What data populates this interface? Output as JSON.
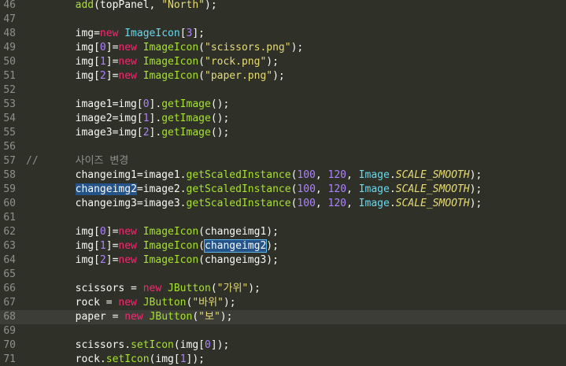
{
  "editor": {
    "lines": [
      {
        "n": "46",
        "tokens": [
          [
            "        ",
            "plain"
          ],
          [
            "add",
            "func"
          ],
          [
            "(topPanel, ",
            "plain"
          ],
          [
            "\"North\"",
            "str"
          ],
          [
            ");",
            "plain"
          ]
        ]
      },
      {
        "n": "47",
        "tokens": []
      },
      {
        "n": "48",
        "tokens": [
          [
            "        img=",
            "plain"
          ],
          [
            "new",
            "kw"
          ],
          [
            " ",
            "plain"
          ],
          [
            "ImageIcon",
            "type"
          ],
          [
            "[",
            "plain"
          ],
          [
            "3",
            "num"
          ],
          [
            "];",
            "plain"
          ]
        ]
      },
      {
        "n": "49",
        "tokens": [
          [
            "        img[",
            "plain"
          ],
          [
            "0",
            "num"
          ],
          [
            "]=",
            "plain"
          ],
          [
            "new",
            "kw"
          ],
          [
            " ",
            "plain"
          ],
          [
            "ImageIcon",
            "func"
          ],
          [
            "(",
            "plain"
          ],
          [
            "\"scissors.png\"",
            "str"
          ],
          [
            ");",
            "plain"
          ]
        ]
      },
      {
        "n": "50",
        "tokens": [
          [
            "        img[",
            "plain"
          ],
          [
            "1",
            "num"
          ],
          [
            "]=",
            "plain"
          ],
          [
            "new",
            "kw"
          ],
          [
            " ",
            "plain"
          ],
          [
            "ImageIcon",
            "func"
          ],
          [
            "(",
            "plain"
          ],
          [
            "\"rock.png\"",
            "str"
          ],
          [
            ");",
            "plain"
          ]
        ]
      },
      {
        "n": "51",
        "tokens": [
          [
            "        img[",
            "plain"
          ],
          [
            "2",
            "num"
          ],
          [
            "]=",
            "plain"
          ],
          [
            "new",
            "kw"
          ],
          [
            " ",
            "plain"
          ],
          [
            "ImageIcon",
            "func"
          ],
          [
            "(",
            "plain"
          ],
          [
            "\"paper.png\"",
            "str"
          ],
          [
            ");",
            "plain"
          ]
        ]
      },
      {
        "n": "52",
        "tokens": []
      },
      {
        "n": "53",
        "tokens": [
          [
            "        image1=img[",
            "plain"
          ],
          [
            "0",
            "num"
          ],
          [
            "].",
            "plain"
          ],
          [
            "getImage",
            "func"
          ],
          [
            "();",
            "plain"
          ]
        ]
      },
      {
        "n": "54",
        "tokens": [
          [
            "        image2=img[",
            "plain"
          ],
          [
            "1",
            "num"
          ],
          [
            "].",
            "plain"
          ],
          [
            "getImage",
            "func"
          ],
          [
            "();",
            "plain"
          ]
        ]
      },
      {
        "n": "55",
        "tokens": [
          [
            "        image3=img[",
            "plain"
          ],
          [
            "2",
            "num"
          ],
          [
            "].",
            "plain"
          ],
          [
            "getImage",
            "func"
          ],
          [
            "();",
            "plain"
          ]
        ]
      },
      {
        "n": "56",
        "tokens": []
      },
      {
        "n": "57",
        "tokens": [
          [
            "//      사이즈 변경",
            "comment"
          ]
        ]
      },
      {
        "n": "58",
        "tokens": [
          [
            "        changeimg1=image1.",
            "plain"
          ],
          [
            "getScaledInstance",
            "func"
          ],
          [
            "(",
            "plain"
          ],
          [
            "100",
            "num"
          ],
          [
            ", ",
            "plain"
          ],
          [
            "120",
            "num"
          ],
          [
            ", ",
            "plain"
          ],
          [
            "Image",
            "type"
          ],
          [
            ".",
            "plain"
          ],
          [
            "SCALE_SMOOTH",
            "const"
          ],
          [
            ");",
            "plain"
          ]
        ]
      },
      {
        "n": "59",
        "tokens": [
          [
            "        ",
            "plain"
          ],
          [
            "changeimg2",
            "sel"
          ],
          [
            "=image2.",
            "plain"
          ],
          [
            "getScaledInstance",
            "func"
          ],
          [
            "(",
            "plain"
          ],
          [
            "100",
            "num"
          ],
          [
            ", ",
            "plain"
          ],
          [
            "120",
            "num"
          ],
          [
            ", ",
            "plain"
          ],
          [
            "Image",
            "type"
          ],
          [
            ".",
            "plain"
          ],
          [
            "SCALE_SMOOTH",
            "const"
          ],
          [
            ");",
            "plain"
          ]
        ]
      },
      {
        "n": "60",
        "tokens": [
          [
            "        changeimg3=image3.",
            "plain"
          ],
          [
            "getScaledInstance",
            "func"
          ],
          [
            "(",
            "plain"
          ],
          [
            "100",
            "num"
          ],
          [
            ", ",
            "plain"
          ],
          [
            "120",
            "num"
          ],
          [
            ", ",
            "plain"
          ],
          [
            "Image",
            "type"
          ],
          [
            ".",
            "plain"
          ],
          [
            "SCALE_SMOOTH",
            "const"
          ],
          [
            ");",
            "plain"
          ]
        ]
      },
      {
        "n": "61",
        "tokens": []
      },
      {
        "n": "62",
        "tokens": [
          [
            "        img[",
            "plain"
          ],
          [
            "0",
            "num"
          ],
          [
            "]=",
            "plain"
          ],
          [
            "new",
            "kw"
          ],
          [
            " ",
            "plain"
          ],
          [
            "ImageIcon",
            "func"
          ],
          [
            "(changeimg1);",
            "plain"
          ]
        ]
      },
      {
        "n": "63",
        "tokens": [
          [
            "        img[",
            "plain"
          ],
          [
            "1",
            "num"
          ],
          [
            "]=",
            "plain"
          ],
          [
            "new",
            "kw"
          ],
          [
            " ",
            "plain"
          ],
          [
            "ImageIcon",
            "func"
          ],
          [
            "(",
            "plain"
          ],
          [
            "changeimg2",
            "selbox"
          ],
          [
            ");",
            "plain"
          ]
        ]
      },
      {
        "n": "64",
        "tokens": [
          [
            "        img[",
            "plain"
          ],
          [
            "2",
            "num"
          ],
          [
            "]=",
            "plain"
          ],
          [
            "new",
            "kw"
          ],
          [
            " ",
            "plain"
          ],
          [
            "ImageIcon",
            "func"
          ],
          [
            "(changeimg3);",
            "plain"
          ]
        ]
      },
      {
        "n": "65",
        "tokens": []
      },
      {
        "n": "66",
        "tokens": [
          [
            "        scissors = ",
            "plain"
          ],
          [
            "new",
            "kw"
          ],
          [
            " ",
            "plain"
          ],
          [
            "JButton",
            "func"
          ],
          [
            "(",
            "plain"
          ],
          [
            "\"가위\"",
            "str"
          ],
          [
            ");",
            "plain"
          ]
        ]
      },
      {
        "n": "67",
        "tokens": [
          [
            "        rock = ",
            "plain"
          ],
          [
            "new",
            "kw"
          ],
          [
            " ",
            "plain"
          ],
          [
            "JButton",
            "func"
          ],
          [
            "(",
            "plain"
          ],
          [
            "\"바위\"",
            "str"
          ],
          [
            ");",
            "plain"
          ]
        ]
      },
      {
        "n": "68",
        "current": true,
        "tokens": [
          [
            "        paper = ",
            "plain"
          ],
          [
            "new",
            "kw"
          ],
          [
            " ",
            "plain"
          ],
          [
            "JButton",
            "func"
          ],
          [
            "(",
            "plain"
          ],
          [
            "\"보\"",
            "str"
          ],
          [
            ");",
            "plain"
          ]
        ]
      },
      {
        "n": "69",
        "tokens": []
      },
      {
        "n": "70",
        "tokens": [
          [
            "        scissors.",
            "plain"
          ],
          [
            "setIcon",
            "func"
          ],
          [
            "(img[",
            "plain"
          ],
          [
            "0",
            "num"
          ],
          [
            "]);",
            "plain"
          ]
        ]
      },
      {
        "n": "71",
        "tokens": [
          [
            "        rock.",
            "plain"
          ],
          [
            "setIcon",
            "func"
          ],
          [
            "(img[",
            "plain"
          ],
          [
            "1",
            "num"
          ],
          [
            "]);",
            "plain"
          ]
        ]
      }
    ]
  },
  "colors": {
    "background": "#2f3129",
    "current_line": "#3c3d36",
    "line_number": "#8f908a",
    "plain": "#f8f8f2",
    "keyword": "#f92672",
    "type": "#66d9ef",
    "function": "#a6e22e",
    "string": "#e6db74",
    "number": "#ae81ff",
    "selection": "#24538a"
  }
}
